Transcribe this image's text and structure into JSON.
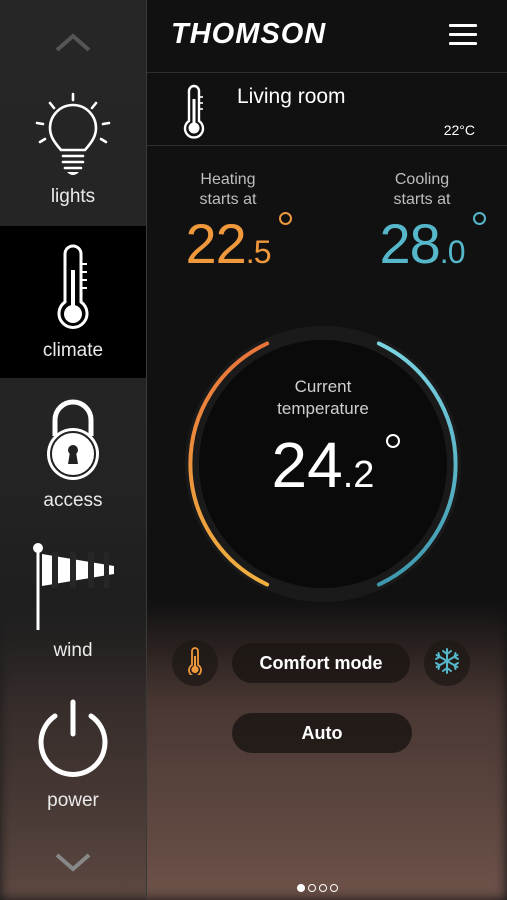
{
  "brand": "THOMSON",
  "colors": {
    "heating": "#f0983c",
    "cooling": "#55b7c9",
    "sidebar_bg": "#262626",
    "active_bg": "#000000"
  },
  "sidebar": {
    "up_icon": "chevron-up-icon",
    "down_icon": "chevron-down-icon",
    "items": [
      {
        "label": "lights",
        "icon": "lightbulb-icon",
        "active": false
      },
      {
        "label": "climate",
        "icon": "thermometer-icon",
        "active": true
      },
      {
        "label": "access",
        "icon": "padlock-icon",
        "active": false
      },
      {
        "label": "wind",
        "icon": "windsock-icon",
        "active": false
      },
      {
        "label": "power",
        "icon": "power-icon",
        "active": false
      }
    ]
  },
  "room": {
    "name": "Living room",
    "temperature": "22°C",
    "icon": "thermometer-icon"
  },
  "heating": {
    "label_line1": "Heating",
    "label_line2": "starts at",
    "whole": "22",
    "decimal": ".5"
  },
  "cooling": {
    "label_line1": "Cooling",
    "label_line2": "starts at",
    "whole": "28",
    "decimal": ".0"
  },
  "current": {
    "label_line1": "Current",
    "label_line2": "temperature",
    "whole": "24",
    "decimal": ".2"
  },
  "controls": {
    "heat_icon": "thermometer-icon",
    "mode_label": "Comfort mode",
    "cool_icon": "snowflake-icon",
    "auto_label": "Auto"
  },
  "pagination": {
    "total": 4,
    "current": 1
  }
}
